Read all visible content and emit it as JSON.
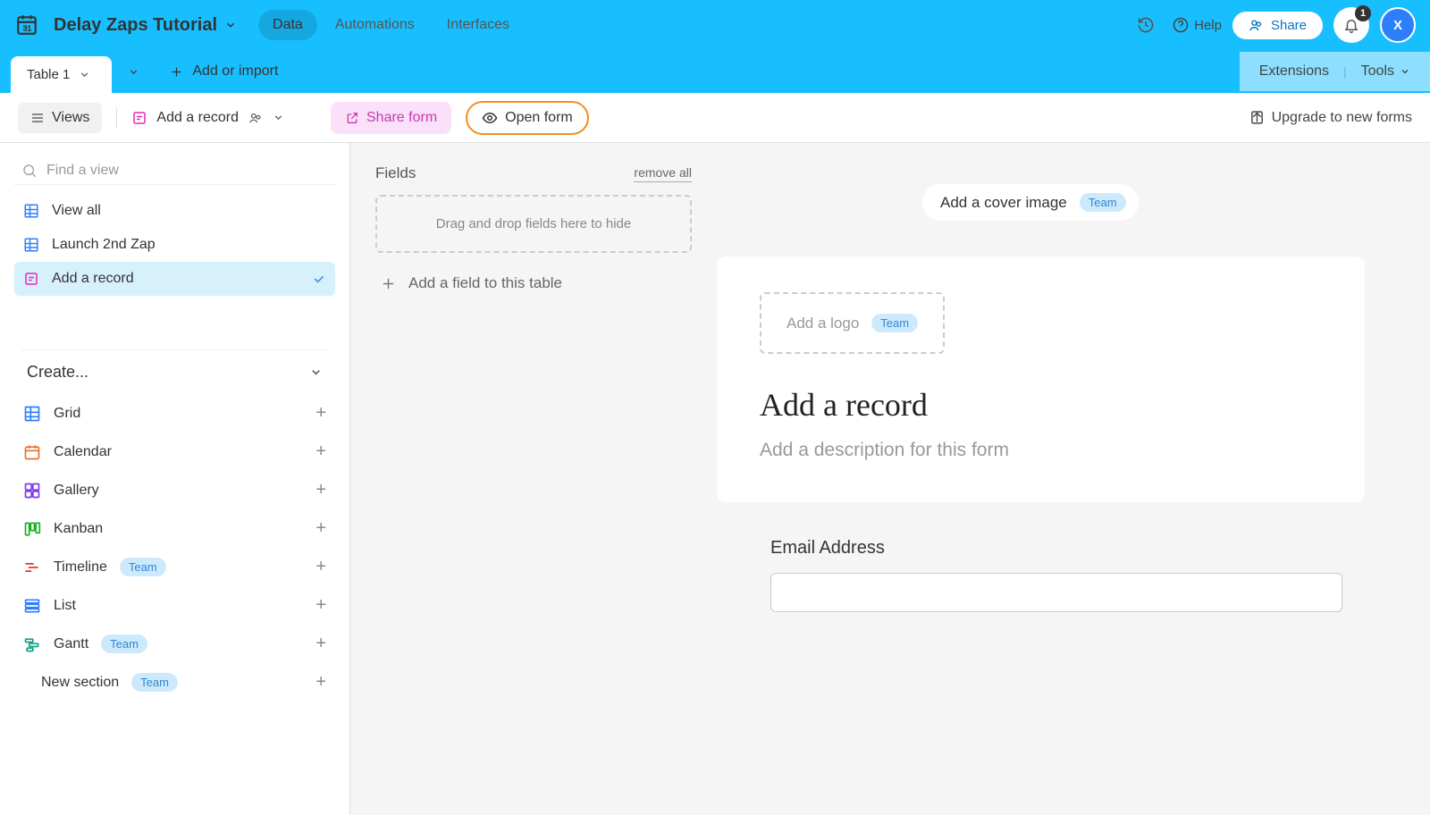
{
  "header": {
    "base_name": "Delay Zaps Tutorial",
    "tabs": [
      "Data",
      "Automations",
      "Interfaces"
    ],
    "active_tab": 0,
    "help_label": "Help",
    "share_label": "Share",
    "notification_count": "1",
    "avatar_initial": "X"
  },
  "table_bar": {
    "active_table": "Table 1",
    "add_label": "Add or import",
    "extensions_label": "Extensions",
    "tools_label": "Tools"
  },
  "toolbar": {
    "views_label": "Views",
    "record_label": "Add a record",
    "share_form_label": "Share form",
    "open_form_label": "Open form",
    "upgrade_label": "Upgrade to new forms"
  },
  "sidebar": {
    "search_placeholder": "Find a view",
    "views": [
      {
        "label": "View all",
        "type": "grid",
        "active": false
      },
      {
        "label": "Launch 2nd Zap",
        "type": "grid",
        "active": false
      },
      {
        "label": "Add a record",
        "type": "form",
        "active": true
      }
    ],
    "create_header": "Create...",
    "create_options": [
      {
        "label": "Grid",
        "icon": "grid",
        "color": "#2d7ff9",
        "badge": null
      },
      {
        "label": "Calendar",
        "icon": "calendar",
        "color": "#e8702a",
        "badge": null
      },
      {
        "label": "Gallery",
        "icon": "gallery",
        "color": "#7c37ef",
        "badge": null
      },
      {
        "label": "Kanban",
        "icon": "kanban",
        "color": "#11af22",
        "badge": null
      },
      {
        "label": "Timeline",
        "icon": "timeline",
        "color": "#e12b28",
        "badge": "Team"
      },
      {
        "label": "List",
        "icon": "list",
        "color": "#2d7ff9",
        "badge": null
      },
      {
        "label": "Gantt",
        "icon": "gantt",
        "color": "#0f9e8e",
        "badge": "Team"
      },
      {
        "label": "New section",
        "icon": "none",
        "color": "#333",
        "badge": "Team"
      }
    ]
  },
  "fields_panel": {
    "title": "Fields",
    "remove_all": "remove all",
    "drop_hint": "Drag and drop fields here to hide",
    "add_field_label": "Add a field to this table"
  },
  "form": {
    "cover_label": "Add a cover image",
    "cover_badge": "Team",
    "logo_label": "Add a logo",
    "logo_badge": "Team",
    "title": "Add a record",
    "description_placeholder": "Add a description for this form",
    "field1_label": "Email Address",
    "field1_value": ""
  }
}
